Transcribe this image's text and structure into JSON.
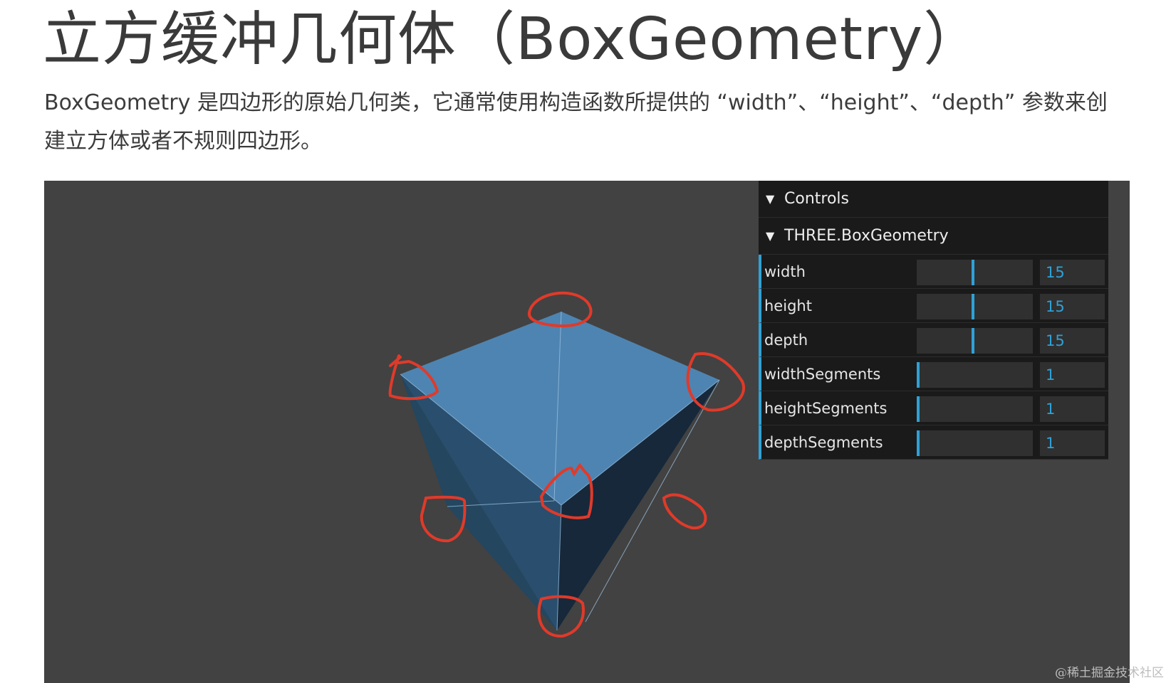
{
  "page": {
    "title": "立方缓冲几何体（BoxGeometry）",
    "description": "BoxGeometry 是四边形的原始几何类，它通常使用构造函数所提供的 “width”、“height”、“depth” 参数来创建立方体或者不规则四边形。"
  },
  "gui": {
    "controls_label": "Controls",
    "folder_label": "THREE.BoxGeometry",
    "params": [
      {
        "label": "width",
        "value": "15",
        "fraction": 0.47
      },
      {
        "label": "height",
        "value": "15",
        "fraction": 0.47
      },
      {
        "label": "depth",
        "value": "15",
        "fraction": 0.47
      },
      {
        "label": "widthSegments",
        "value": "1",
        "fraction": 0.0
      },
      {
        "label": "heightSegments",
        "value": "1",
        "fraction": 0.0
      },
      {
        "label": "depthSegments",
        "value": "1",
        "fraction": 0.0
      }
    ]
  },
  "watermark": "@稀土掘金技术社区",
  "colors": {
    "viewport_bg": "#424242",
    "cube_top": "#4e84b1",
    "cube_left": "#2a4f6e",
    "cube_right": "#16283a",
    "annotation": "#e03a2a",
    "accent": "#2fa1d6"
  }
}
